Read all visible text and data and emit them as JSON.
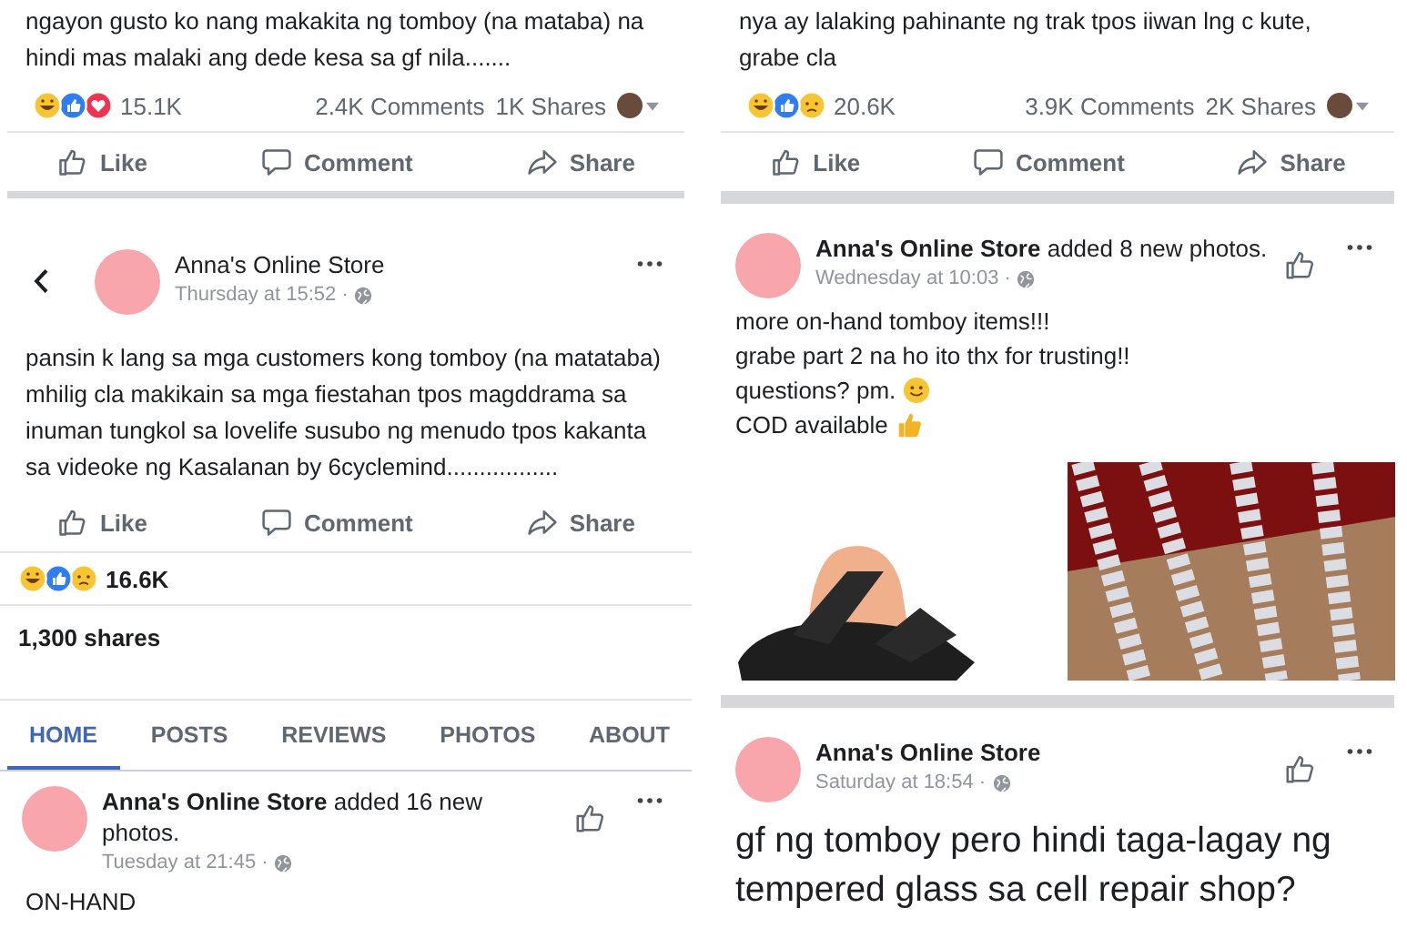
{
  "columns": [
    {
      "items": [
        {
          "kind": "text",
          "text": "ngayon gusto ko nang makakita ng tomboy (na mataba) na\nhindi mas malaki ang dede kesa sa gf nila......."
        },
        {
          "kind": "stats",
          "reactions": [
            {
              "kind": "haha"
            },
            {
              "kind": "like"
            },
            {
              "kind": "love"
            }
          ],
          "count": "15.1K",
          "comments": "2.4K Comments",
          "shares": "1K Shares"
        },
        {
          "kind": "actions",
          "labels": [
            "Like",
            "Comment",
            "Share"
          ]
        },
        {
          "kind": "separator"
        },
        {
          "kind": "header",
          "back": true,
          "like": false,
          "title": "Anna's Online Store",
          "time": "Thursday at 15:52 ·"
        },
        {
          "kind": "text",
          "text": "pansin k lang sa mga customers kong tomboy (na matataba)\nmhilig cla makikain sa mga fiestahan tpos magddrama sa\ninuman tungkol sa lovelife susubo ng menudo tpos kakanta\nsa videoke ng Kasalanan by 6cyclemind................."
        },
        {
          "kind": "actions",
          "labels": [
            "Like",
            "Comment",
            "Share"
          ]
        },
        {
          "kind": "summary",
          "reactions": [
            {
              "kind": "haha"
            },
            {
              "kind": "like"
            },
            {
              "kind": "sad"
            }
          ],
          "count": "16.6K"
        },
        {
          "kind": "line",
          "text": "1,300 shares"
        },
        {
          "kind": "tabs",
          "tabs": [
            {
              "label": "HOME",
              "selected": true
            },
            {
              "label": "POSTS",
              "selected": false
            },
            {
              "label": "REVIEWS",
              "selected": false
            },
            {
              "label": "PHOTOS",
              "selected": false
            },
            {
              "label": "ABOUT",
              "selected": false
            }
          ]
        },
        {
          "kind": "header",
          "back": false,
          "like": true,
          "title": "**Anna's Online Store** added 16 new\nphotos.",
          "time": "Tuesday at 21:45 ·"
        },
        {
          "kind": "text",
          "text": "ON-HAND"
        }
      ]
    },
    {
      "items": [
        {
          "kind": "text",
          "text": "nya ay lalaking pahinante ng trak tpos iiwan lng c kute,\ngrabe cla"
        },
        {
          "kind": "stats",
          "reactions": [
            {
              "kind": "haha"
            },
            {
              "kind": "like"
            },
            {
              "kind": "sad"
            }
          ],
          "count": "20.6K",
          "comments": "3.9K Comments",
          "shares": "2K Shares"
        },
        {
          "kind": "actions",
          "labels": [
            "Like",
            "Comment",
            "Share"
          ]
        },
        {
          "kind": "separator"
        },
        {
          "kind": "header",
          "back": false,
          "like": true,
          "title": "**Anna's Online Store** added 8 new photos.",
          "time": "Wednesday at 10:03 ·"
        },
        {
          "kind": "lines",
          "lines": [
            {
              "text": "more on-hand tomboy items!!!"
            },
            {
              "text": "grabe part 2 na ho ito thx for trusting!!"
            },
            {
              "text": "questions? pm.",
              "kind": "smile"
            },
            {
              "text": "COD available",
              "kind": "thumb"
            }
          ]
        },
        {
          "kind": "photos",
          "photos": [
            {
              "kind": "sandal"
            },
            {
              "kind": "chain"
            }
          ]
        },
        {
          "kind": "separator"
        },
        {
          "kind": "header",
          "back": false,
          "like": true,
          "title": "**Anna's Online Store**",
          "time": "Saturday at 18:54 ·"
        },
        {
          "kind": "bigtext",
          "text": "gf ng tomboy pero hindi taga-lagay ng\ntempered glass sa cell repair shop?"
        }
      ]
    }
  ]
}
